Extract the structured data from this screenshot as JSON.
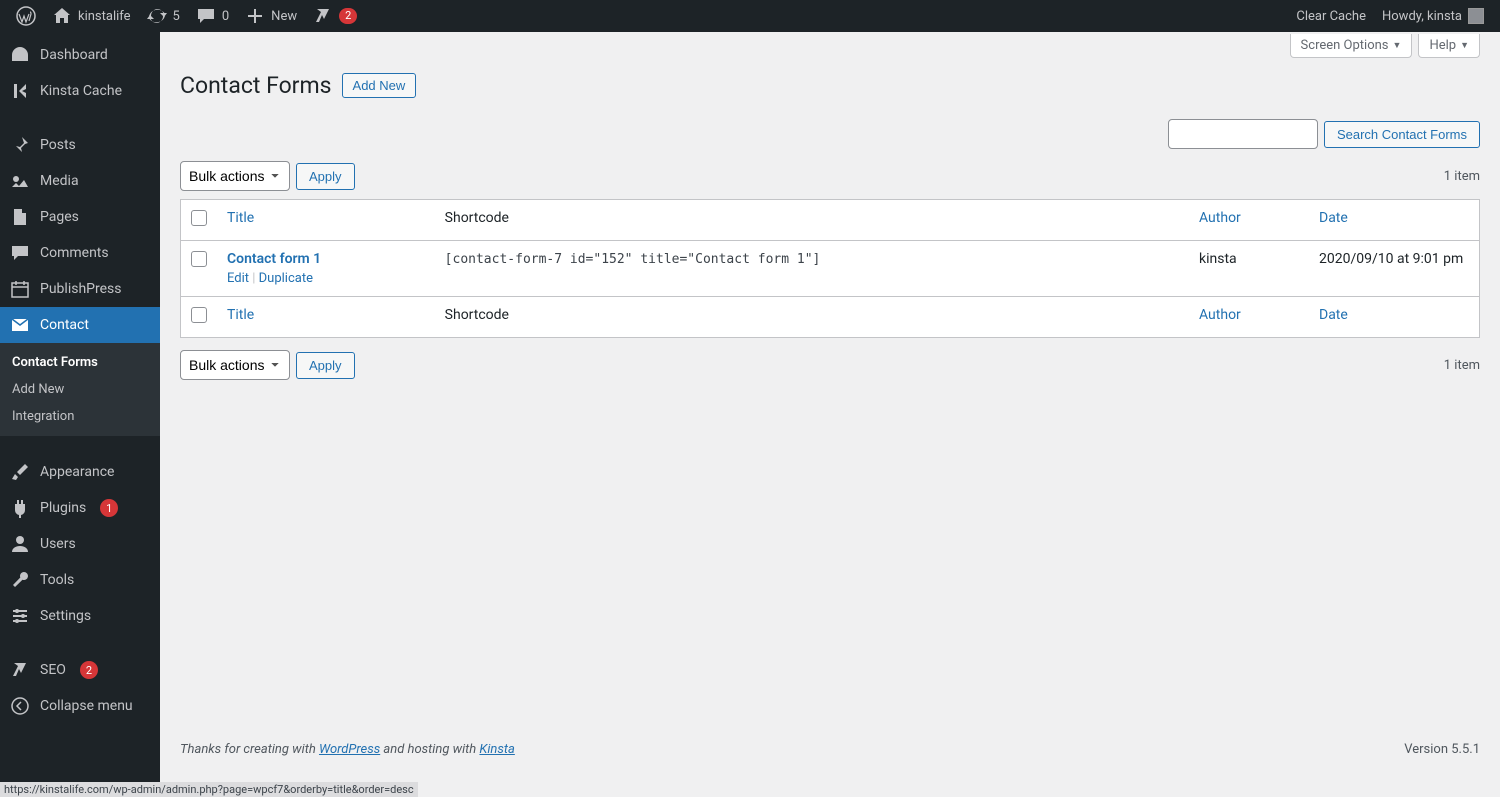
{
  "adminbar": {
    "site_name": "kinstalife",
    "updates": "5",
    "comments": "0",
    "new_label": "New",
    "yoast_badge": "2",
    "clear_cache": "Clear Cache",
    "howdy": "Howdy, kinsta"
  },
  "sidebar": {
    "dashboard": "Dashboard",
    "kinsta_cache": "Kinsta Cache",
    "posts": "Posts",
    "media": "Media",
    "pages": "Pages",
    "comments": "Comments",
    "publishpress": "PublishPress",
    "contact": "Contact",
    "submenu": {
      "contact_forms": "Contact Forms",
      "add_new": "Add New",
      "integration": "Integration"
    },
    "appearance": "Appearance",
    "plugins": "Plugins",
    "plugins_count": "1",
    "users": "Users",
    "tools": "Tools",
    "settings": "Settings",
    "seo": "SEO",
    "seo_count": "2",
    "collapse": "Collapse menu"
  },
  "header": {
    "title": "Contact Forms",
    "add_new": "Add New",
    "screen_options": "Screen Options",
    "help": "Help"
  },
  "search": {
    "button": "Search Contact Forms"
  },
  "bulk": {
    "label": "Bulk actions",
    "apply": "Apply"
  },
  "count_label": "1 item",
  "table": {
    "title": "Title",
    "shortcode": "Shortcode",
    "author": "Author",
    "date": "Date",
    "row": {
      "title": "Contact form 1",
      "edit": "Edit",
      "duplicate": "Duplicate",
      "shortcode": "[contact-form-7 id=\"152\" title=\"Contact form 1\"]",
      "author": "kinsta",
      "date": "2020/09/10 at 9:01 pm"
    }
  },
  "footer": {
    "thanks_prefix": "Thanks for creating with ",
    "wp": "WordPress",
    "mid": " and hosting with ",
    "kinsta": "Kinsta",
    "version": "Version 5.5.1"
  },
  "status_url": "https://kinstalife.com/wp-admin/admin.php?page=wpcf7&orderby=title&order=desc"
}
